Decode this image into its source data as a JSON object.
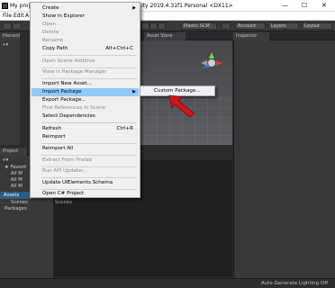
{
  "titlebar": {
    "left_text": "My proje",
    "center_text": "ity 2019.4.31f1 Personal <DX11>",
    "minimize": "—",
    "maximize": "☐",
    "close": "✕"
  },
  "menubar": {
    "items": [
      "File",
      "Edit",
      "A"
    ]
  },
  "toolbar": {
    "plastic_scm": "Plastic SCM",
    "account": "Account",
    "layers": "Layers",
    "layout": "Layout"
  },
  "tabs": {
    "hierarchy": "Hierarchy",
    "asset_store": "Asset Store",
    "inspector": "Inspector",
    "project": "Project"
  },
  "project_panel": {
    "favorites": "Favorit",
    "fav_items": [
      "All M",
      "All M",
      "All M"
    ],
    "assets": "Assets",
    "scenes": "Scenes",
    "packages": "Packages",
    "content_item": "Scenes"
  },
  "context_menu": {
    "items": [
      {
        "label": "Create",
        "shortcut": "",
        "arrow": true,
        "disabled": false
      },
      {
        "label": "Show in Explorer",
        "shortcut": "",
        "arrow": false,
        "disabled": false
      },
      {
        "label": "Open",
        "shortcut": "",
        "arrow": false,
        "disabled": true
      },
      {
        "label": "Delete",
        "shortcut": "",
        "arrow": false,
        "disabled": true
      },
      {
        "label": "Rename",
        "shortcut": "",
        "arrow": false,
        "disabled": true
      },
      {
        "label": "Copy Path",
        "shortcut": "Alt+Ctrl+C",
        "arrow": false,
        "disabled": false
      },
      {
        "label": "Open Scene Additive",
        "shortcut": "",
        "arrow": false,
        "disabled": true
      },
      {
        "label": "View in Package Manager",
        "shortcut": "",
        "arrow": false,
        "disabled": true
      },
      {
        "label": "Import New Asset...",
        "shortcut": "",
        "arrow": false,
        "disabled": false
      },
      {
        "label": "Import Package",
        "shortcut": "",
        "arrow": true,
        "disabled": false
      },
      {
        "label": "Export Package...",
        "shortcut": "",
        "arrow": false,
        "disabled": false
      },
      {
        "label": "Find References In Scene",
        "shortcut": "",
        "arrow": false,
        "disabled": true
      },
      {
        "label": "Select Dependencies",
        "shortcut": "",
        "arrow": false,
        "disabled": false
      },
      {
        "label": "Refresh",
        "shortcut": "Ctrl+R",
        "arrow": false,
        "disabled": false
      },
      {
        "label": "Reimport",
        "shortcut": "",
        "arrow": false,
        "disabled": false
      },
      {
        "label": "Reimport All",
        "shortcut": "",
        "arrow": false,
        "disabled": false
      },
      {
        "label": "Extract From Prefab",
        "shortcut": "",
        "arrow": false,
        "disabled": true
      },
      {
        "label": "Run API Updater...",
        "shortcut": "",
        "arrow": false,
        "disabled": true
      },
      {
        "label": "Update UIElements Schema",
        "shortcut": "",
        "arrow": false,
        "disabled": false
      },
      {
        "label": "Open C# Project",
        "shortcut": "",
        "arrow": false,
        "disabled": false
      }
    ]
  },
  "submenu": {
    "item": "Custom Package..."
  },
  "status": {
    "text": "Auto Generate Lighting Off"
  },
  "colors": {
    "highlight": "#91c9f7",
    "annotation_arrow": "#d4141c"
  }
}
